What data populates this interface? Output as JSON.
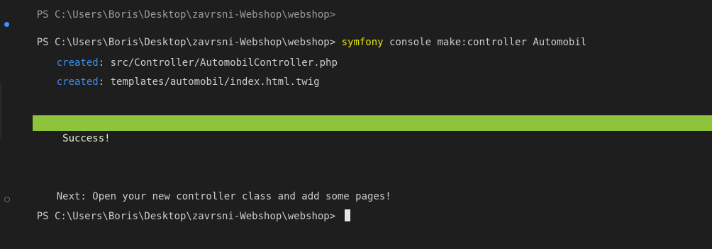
{
  "terminal": {
    "top_partial": "PS C:\\Users\\Boris\\Desktop\\zavrsni-Webshop\\webshop>",
    "prompt1": "PS C:\\Users\\Boris\\Desktop\\zavrsni-Webshop\\webshop> ",
    "command_word": "symfony",
    "command_rest": " console make:controller Automobil",
    "created_label_1": "created",
    "created_path_1": ": src/Controller/AutomobilController.php",
    "created_label_2": "created",
    "created_path_2": ": templates/automobil/index.html.twig",
    "success_text": " Success!",
    "next_text": "Next: Open your new controller class and add some pages!",
    "prompt2": "PS C:\\Users\\Boris\\Desktop\\zavrsni-Webshop\\webshop> "
  },
  "colors": {
    "background": "#1e1e1e",
    "text": "#cccccc",
    "command": "#e5e510",
    "created": "#3b8eea",
    "success_bar": "#8ec33c",
    "marker_active": "#3794ff"
  }
}
